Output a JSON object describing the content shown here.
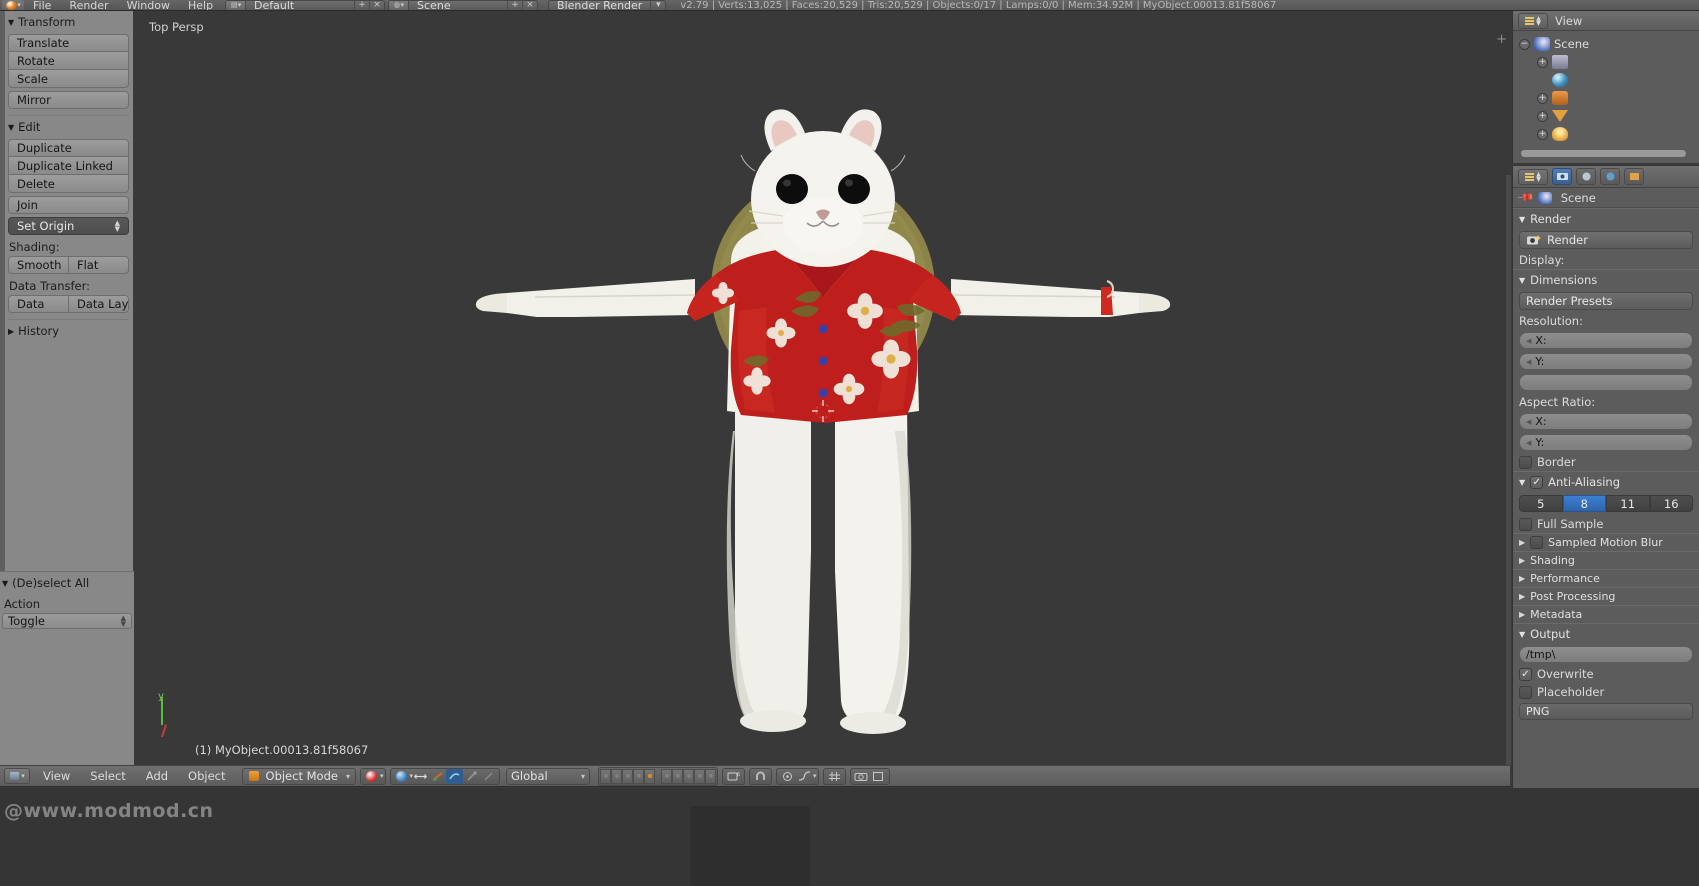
{
  "topbar": {
    "app_icon": "blender-logo-icon",
    "menus": [
      "File",
      "Render",
      "Window",
      "Help"
    ],
    "screen_layout": {
      "icon": "screen-layout-icon",
      "value": "Default",
      "add_label": "+",
      "remove_label": "×"
    },
    "scene": {
      "icon": "scene-icon",
      "value": "Scene",
      "add_label": "+",
      "remove_label": "×"
    },
    "engine": {
      "value": "Blender Render"
    },
    "stats": "v2.79 | Verts:13,025 | Faces:20,529 | Tris:20,529 | Objects:0/17 | Lamps:0/0 | Mem:34.92M | MyObject.00013.81f58067"
  },
  "toolshelf": {
    "transform": {
      "title": "Transform",
      "buttons": [
        "Translate",
        "Rotate",
        "Scale"
      ],
      "mirror": "Mirror"
    },
    "edit": {
      "title": "Edit",
      "buttons": [
        "Duplicate",
        "Duplicate Linked",
        "Delete"
      ],
      "join": "Join",
      "set_origin": "Set Origin",
      "shading_label": "Shading:",
      "shading_buttons": [
        "Smooth",
        "Flat"
      ],
      "data_transfer_label": "Data Transfer:",
      "data_transfer_buttons": [
        "Data",
        "Data Layo"
      ]
    },
    "history": {
      "title": "History"
    }
  },
  "operator_panel": {
    "title": "(De)select All",
    "action_label": "Action",
    "action_value": "Toggle"
  },
  "viewport": {
    "view_label": "Top Persp",
    "object_label": "(1) MyObject.00013.81f58067",
    "axis_y": "y"
  },
  "viewport_header": {
    "editor_type_icon": "editor-type-icon",
    "menus": [
      "View",
      "Select",
      "Add",
      "Object"
    ],
    "mode": {
      "icon": "object-mode-icon",
      "value": "Object Mode"
    },
    "orientation": {
      "value": "Global"
    },
    "layers_active_index": 4
  },
  "outliner": {
    "display_mode_icon": "outliner-display-mode-icon",
    "view_menu": "View",
    "tree": [
      {
        "label": "Scene",
        "icon": "scene-icon",
        "expander": "−",
        "indent": 0
      },
      {
        "label": "",
        "icon": "render-layers-icon",
        "expander": "+",
        "indent": 1
      },
      {
        "label": "",
        "icon": "world-icon",
        "expander": "",
        "indent": 1
      },
      {
        "label": "",
        "icon": "camera-icon",
        "expander": "+",
        "indent": 1
      },
      {
        "label": "",
        "icon": "mesh-icon",
        "expander": "+",
        "indent": 1
      },
      {
        "label": "",
        "icon": "lamp-icon",
        "expander": "+",
        "indent": 1
      }
    ]
  },
  "properties": {
    "breadcrumb_icon": "pin-icon",
    "breadcrumb_scene_icon": "scene-icon",
    "breadcrumb": "Scene",
    "tabs": [
      "render-tab",
      "scene-tab",
      "world-tab",
      "object-tab"
    ],
    "render": {
      "title": "Render",
      "render_button": "Render",
      "render_button_icon": "camera-render-icon",
      "display_label": "Display:"
    },
    "dimensions": {
      "title": "Dimensions",
      "presets_button": "Render Presets",
      "resolution_label": "Resolution:",
      "res_x_label": "X:",
      "res_y_label": "Y:",
      "aspect_label": "Aspect Ratio:",
      "aspect_x_label": "X:",
      "aspect_y_label": "Y:",
      "border_label": "Border"
    },
    "antialiasing": {
      "title": "Anti-Aliasing",
      "checked": true,
      "options": [
        "5",
        "8",
        "11",
        "16"
      ],
      "selected": "8",
      "full_sample_label": "Full Sample"
    },
    "collapsed_sections": [
      {
        "label": "Sampled Motion Blur",
        "has_checkbox": true
      },
      {
        "label": "Shading",
        "has_checkbox": false
      },
      {
        "label": "Performance",
        "has_checkbox": false
      },
      {
        "label": "Post Processing",
        "has_checkbox": false
      },
      {
        "label": "Metadata",
        "has_checkbox": false
      }
    ],
    "output": {
      "title": "Output",
      "path": "/tmp\\",
      "overwrite_label": "Overwrite",
      "overwrite_checked": true,
      "placeholder_label": "Placeholder",
      "file_format": "PNG"
    }
  },
  "watermark": {
    "text": "@www.modmod.cn"
  },
  "colors": {
    "panel_bg": "#888888",
    "viewport_bg": "#393939",
    "header_bg": "#666666",
    "accent_blue": "#3c7fd4",
    "accent_orange": "#e8862a",
    "shirt_red": "#c0241f",
    "fur_white": "#f2f2ee",
    "hat_olive": "#8b8347"
  }
}
